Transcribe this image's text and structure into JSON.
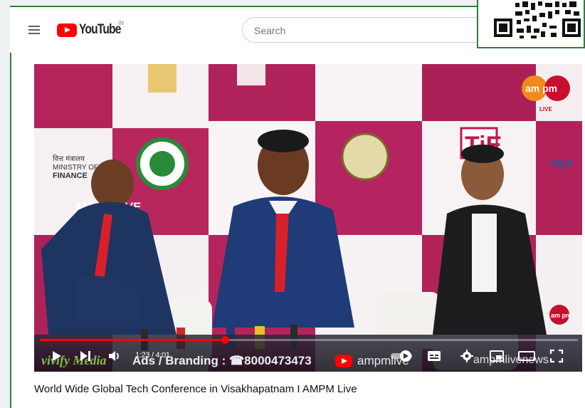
{
  "header": {
    "logo_text": "YouTube",
    "country_code": "IN",
    "search_placeholder": "Search"
  },
  "video": {
    "ticker_ads": "Ads / Branding : ☎8000473473",
    "ticker_channel": "ampmlive",
    "ticker_social": "ampmlivenews",
    "producer": "vivify Media",
    "current_time": "1:23",
    "duration": "4:01",
    "progress": 0.344,
    "watermark": "AMPM LIVE",
    "banner_ministry_hi": "वित्त मंत्रालय",
    "banner_ministry_en_1": "MINISTRY OF",
    "banner_ministry_en_2": "FINANCE",
    "channel_logo": "am pm",
    "channel_logo_sub": "LIVE",
    "corner_logo": "am pm",
    "banner_tie": "TiE",
    "banner_hyd": "Hyd"
  },
  "title": "World Wide Global Tech Conference in Visakhapatnam I AMPM Live",
  "colors": {
    "brand_red": "#ff0000",
    "frame_green": "#2f7d3a",
    "backdrop_magenta": "#b3245a"
  }
}
